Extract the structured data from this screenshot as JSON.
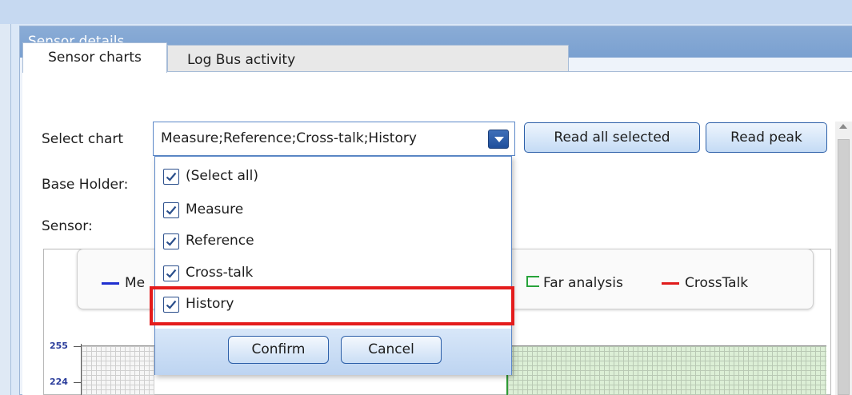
{
  "panel": {
    "title": "Sensor details"
  },
  "tabs": [
    {
      "label": "Sensor charts",
      "active": true
    },
    {
      "label": "Log Bus activity",
      "active": false
    }
  ],
  "form": {
    "select_chart_label": "Select chart",
    "select_chart_value": "Measure;Reference;Cross-talk;History",
    "base_holder_label": "Base Holder:",
    "sensor_label": "Sensor:"
  },
  "buttons": {
    "read_all_selected": "Read all selected",
    "read_peak": "Read peak"
  },
  "dropdown": {
    "items": [
      {
        "label": "(Select all)",
        "checked": true
      },
      {
        "label": "Measure",
        "checked": true
      },
      {
        "label": "Reference",
        "checked": true
      },
      {
        "label": "Cross-talk",
        "checked": true
      },
      {
        "label": "History",
        "checked": true
      }
    ],
    "confirm_label": "Confirm",
    "cancel_label": "Cancel"
  },
  "legend": {
    "items": [
      {
        "label": "Me",
        "color": "#1f2fd0"
      },
      {
        "label": "Far analysis",
        "color": "#27a33a"
      },
      {
        "label": "CrossTalk",
        "color": "#e01b1b"
      }
    ]
  },
  "chart": {
    "y_ticks": [
      "255",
      "224"
    ]
  },
  "colors": {
    "accent": "#5c88c8",
    "highlight": "#e41c1c",
    "header": "#7aa0d0"
  }
}
